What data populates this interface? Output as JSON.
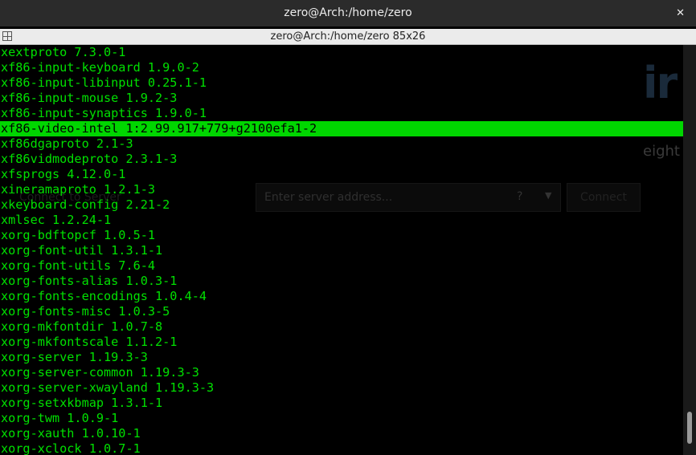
{
  "window": {
    "title": "zero@Arch:/home/zero",
    "close_glyph": "✕"
  },
  "terminal": {
    "title": "zero@Arch:/home/zero 85x26",
    "selected_index": 5,
    "lines": [
      "xextproto 7.3.0-1",
      "xf86-input-keyboard 1.9.0-2",
      "xf86-input-libinput 0.25.1-1",
      "xf86-input-mouse 1.9.2-3",
      "xf86-input-synaptics 1.9.0-1",
      "xf86-video-intel 1:2.99.917+779+g2100efa1-2",
      "xf86dgaproto 2.1-3",
      "xf86vidmodeproto 2.3.1-3",
      "xfsprogs 4.12.0-1",
      "xineramaproto 1.2.1-3",
      "xkeyboard-config 2.21-2",
      "xmlsec 1.2.24-1",
      "xorg-bdftopcf 1.0.5-1",
      "xorg-font-util 1.3.1-1",
      "xorg-font-utils 7.6-4",
      "xorg-fonts-alias 1.0.3-1",
      "xorg-fonts-encodings 1.0.4-4",
      "xorg-fonts-misc 1.0.3-5",
      "xorg-mkfontdir 1.0.7-8",
      "xorg-mkfontscale 1.1.2-1",
      "xorg-server 1.19.3-3",
      "xorg-server-common 1.19.3-3",
      "xorg-server-xwayland 1.19.3-3",
      "xorg-setxkbmap 1.3.1-1",
      "xorg-twm 1.0.9-1",
      "xorg-xauth 1.0.10-1",
      "xorg-xclock 1.0.7-1"
    ]
  },
  "background": {
    "logo_fragment": "ir",
    "logo_subtext": "eight",
    "server_label": "Connect to Server",
    "server_placeholder": "Enter server address...",
    "help_glyph": "?",
    "dropdown_glyph": "▼",
    "connect_label": "Connect"
  },
  "colors": {
    "text_green": "#00e000",
    "selection_green": "#00d600",
    "titlebar": "#2b2b2b"
  }
}
